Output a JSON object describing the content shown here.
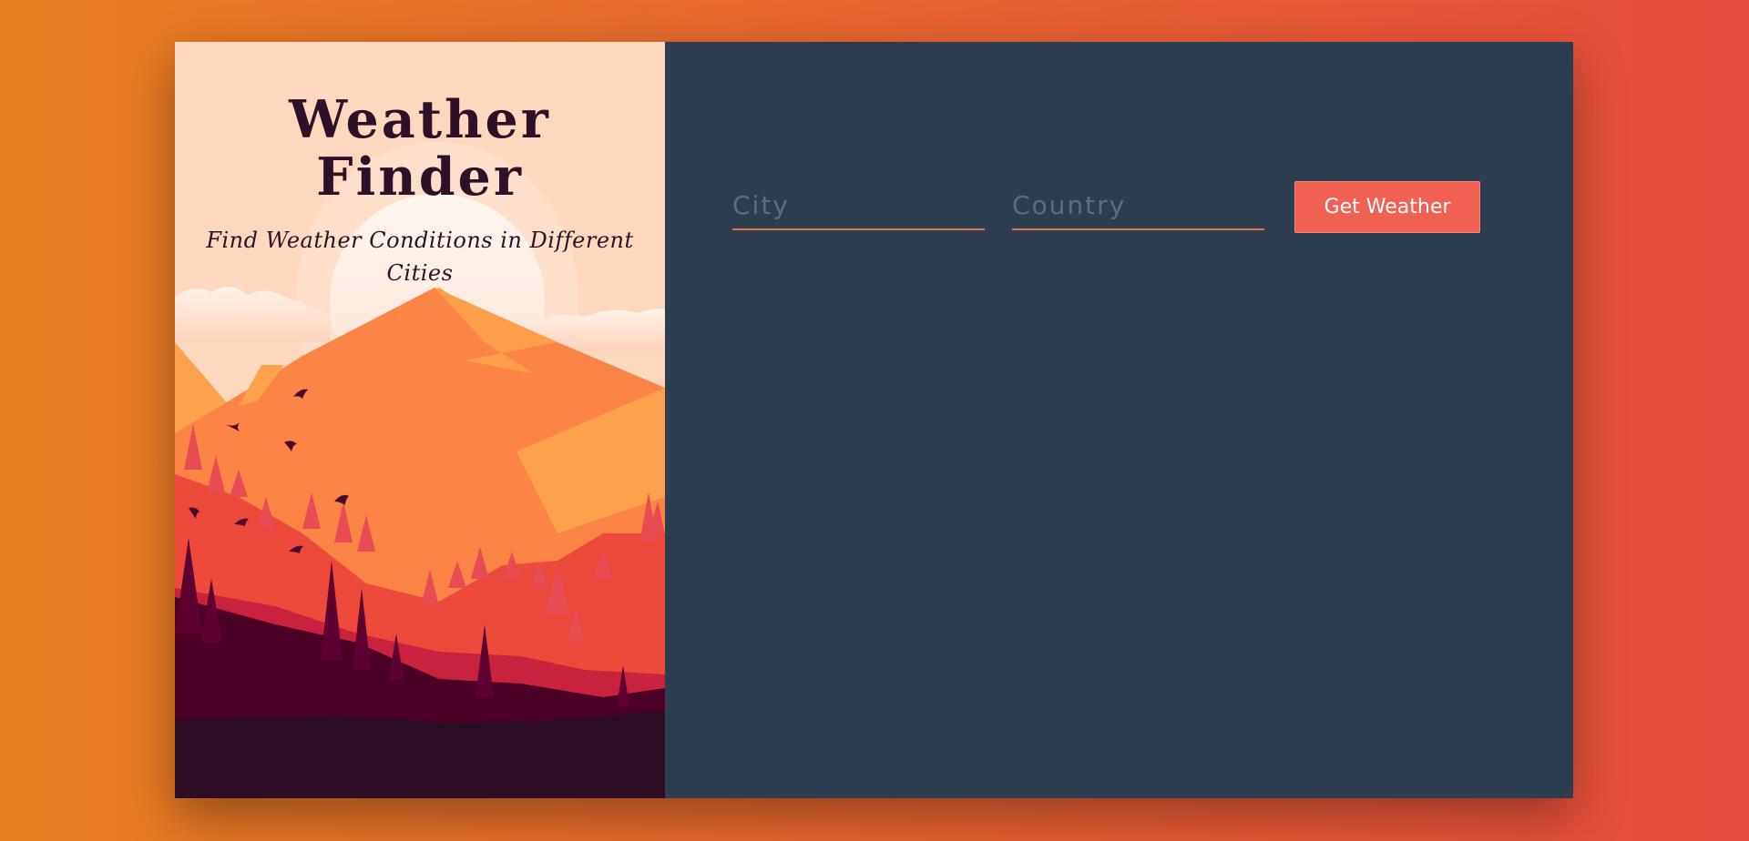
{
  "header": {
    "title": "Weather Finder",
    "subtitle": "Find Weather Conditions in Different Cities"
  },
  "form": {
    "city_placeholder": "City",
    "city_value": "",
    "country_placeholder": "Country",
    "country_value": "",
    "submit_label": "Get Weather"
  },
  "colors": {
    "background_gradient_start": "#e67e22",
    "background_gradient_end": "#e74c3c",
    "panel": "#2c3e50",
    "button": "#f16051",
    "input_underline": "#e0704f",
    "title_text": "#2c1128"
  },
  "icons": {
    "illustration": "mountain-landscape-illustration"
  }
}
